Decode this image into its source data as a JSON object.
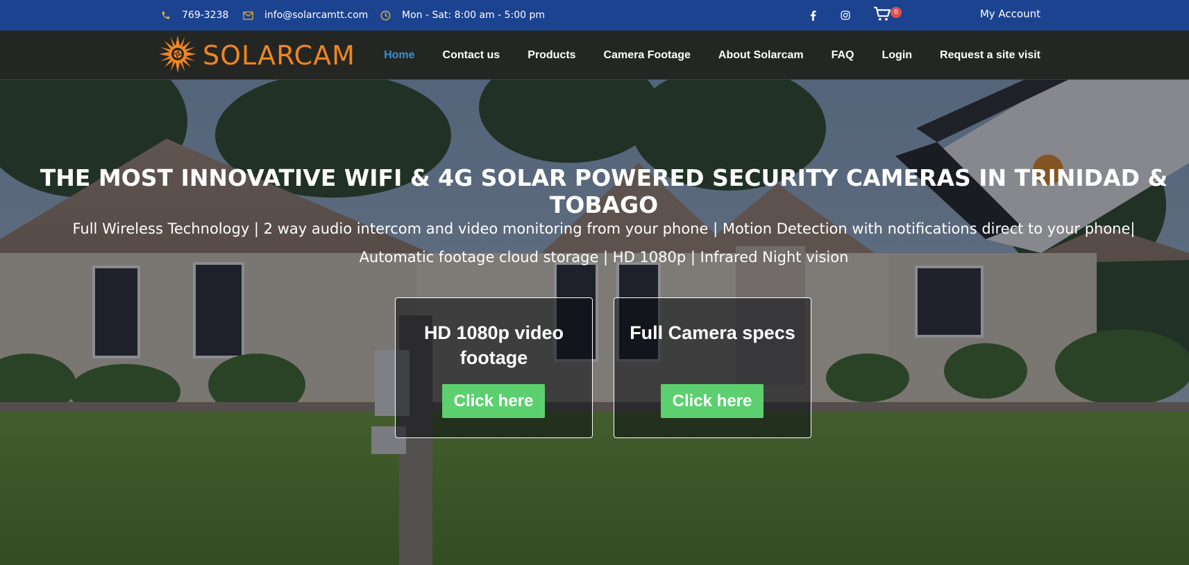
{
  "topbar": {
    "phone": "769-3238",
    "email": "info@solarcamtt.com",
    "hours": "Mon - Sat: 8:00 am - 5:00 pm",
    "cart_count": "0",
    "account_label": "My Account"
  },
  "header": {
    "brand": "SOLARCAM"
  },
  "nav": {
    "items": [
      {
        "label": "Home",
        "active": true
      },
      {
        "label": "Contact us"
      },
      {
        "label": "Products"
      },
      {
        "label": "Camera Footage"
      },
      {
        "label": "About Solarcam"
      },
      {
        "label": "FAQ"
      },
      {
        "label": "Login"
      },
      {
        "label": "Request a site visit"
      }
    ]
  },
  "hero": {
    "title": "THE MOST INNOVATIVE WIFI & 4G SOLAR POWERED SECURITY CAMERAS IN TRINIDAD & TOBAGO",
    "subtitle_line1": "Full Wireless Technology | 2 way audio intercom and video monitoring from your phone | Motion Detection with notifications direct to your phone|",
    "subtitle_line2": "Automatic footage cloud storage | HD 1080p | Infrared Night vision",
    "cards": [
      {
        "title": "HD 1080p video footage",
        "button": "Click here"
      },
      {
        "title": "Full Camera specs",
        "button": "Click here"
      }
    ]
  },
  "colors": {
    "topbar_bg": "#1c438f",
    "nav_bg": "#242624",
    "accent_gold": "#e9b62b",
    "brand_orange": "#f0861e",
    "active_link": "#3a8fd1",
    "button_green": "#5ccf6f",
    "badge_red": "#d9534f"
  },
  "icons": [
    "phone-icon",
    "envelope-icon",
    "clock-icon",
    "facebook-icon",
    "instagram-icon",
    "cart-icon",
    "sun-logo-icon"
  ]
}
